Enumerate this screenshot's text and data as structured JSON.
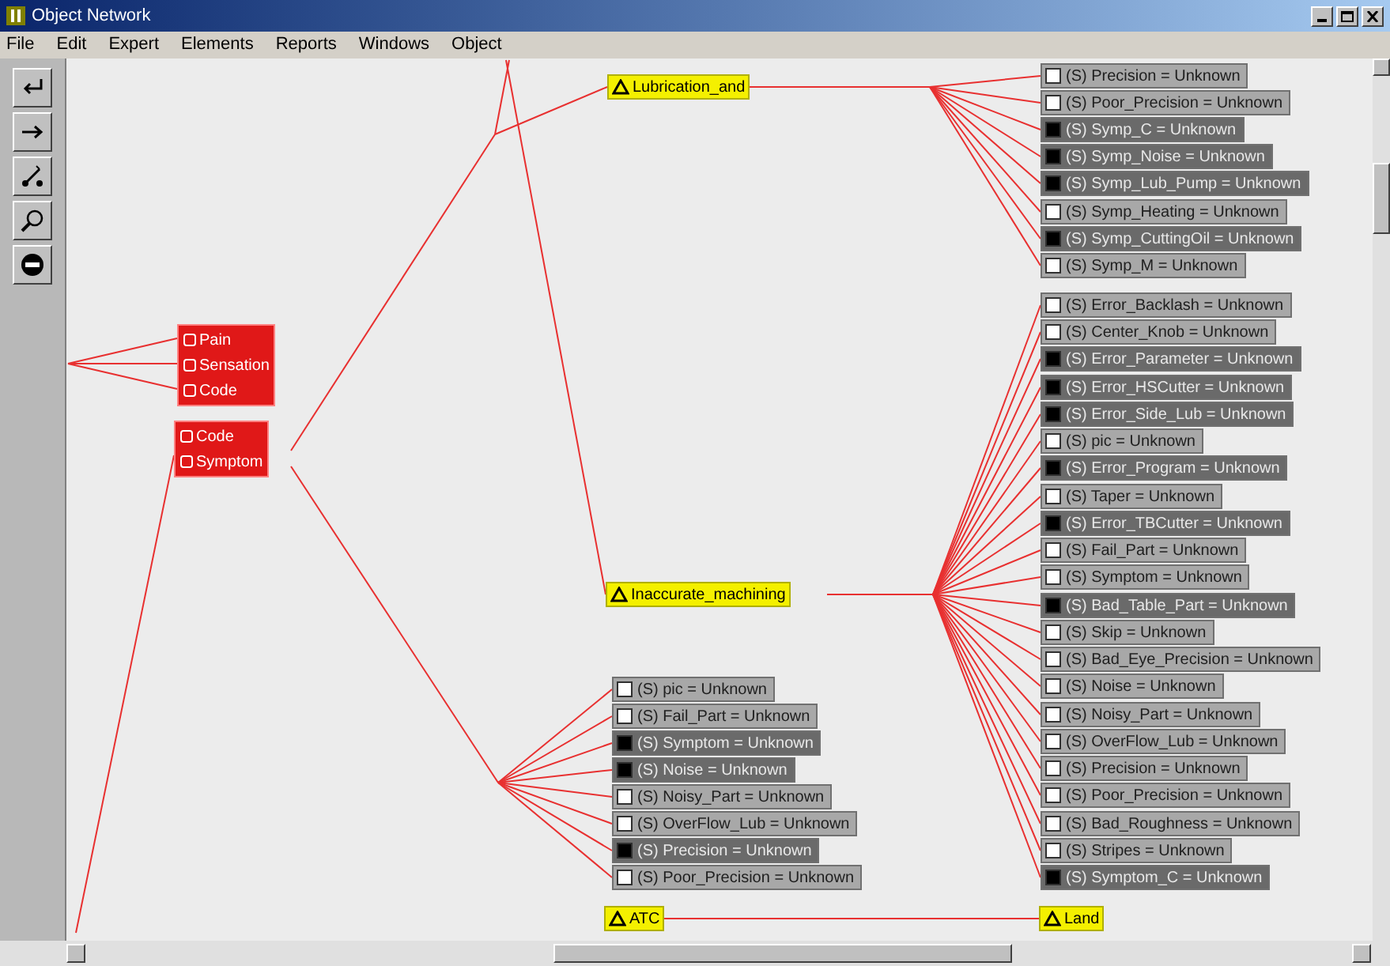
{
  "window": {
    "title": "Object Network"
  },
  "menu": [
    "File",
    "Edit",
    "Expert",
    "Elements",
    "Reports",
    "Windows",
    "Object"
  ],
  "object_groups": [
    {
      "items": [
        "Pain",
        "Sensation",
        "Code"
      ]
    },
    {
      "items": [
        "Code",
        "Symptom"
      ]
    }
  ],
  "rules": [
    {
      "label": "Lubrication_and"
    },
    {
      "label": "Inaccurate_machining"
    },
    {
      "label": "ATC"
    },
    {
      "label": "Land"
    }
  ],
  "attribute_lists": [
    {
      "items": [
        {
          "label": "(S) pic = Unknown",
          "checked": false
        },
        {
          "label": "(S) Fail_Part = Unknown",
          "checked": false
        },
        {
          "label": "(S) Symptom = Unknown",
          "checked": true
        },
        {
          "label": "(S) Noise = Unknown",
          "checked": true
        },
        {
          "label": "(S) Noisy_Part = Unknown",
          "checked": false
        },
        {
          "label": "(S) OverFlow_Lub = Unknown",
          "checked": false
        },
        {
          "label": "(S) Precision = Unknown",
          "checked": true
        },
        {
          "label": "(S) Poor_Precision = Unknown",
          "checked": false
        }
      ]
    },
    {
      "items": [
        {
          "label": "(S) Precision = Unknown",
          "checked": false
        },
        {
          "label": "(S) Poor_Precision = Unknown",
          "checked": false
        },
        {
          "label": "(S) Symp_C = Unknown",
          "checked": true
        },
        {
          "label": "(S) Symp_Noise = Unknown",
          "checked": true
        },
        {
          "label": "(S) Symp_Lub_Pump = Unknown",
          "checked": true
        },
        {
          "label": "(S) Symp_Heating = Unknown",
          "checked": false
        },
        {
          "label": "(S) Symp_CuttingOil = Unknown",
          "checked": true
        },
        {
          "label": "(S) Symp_M = Unknown",
          "checked": false
        }
      ]
    },
    {
      "items": [
        {
          "label": "(S) Error_Backlash = Unknown",
          "checked": false
        },
        {
          "label": "(S) Center_Knob = Unknown",
          "checked": false
        },
        {
          "label": "(S) Error_Parameter = Unknown",
          "checked": true
        },
        {
          "label": "(S) Error_HSCutter = Unknown",
          "checked": true
        },
        {
          "label": "(S) Error_Side_Lub = Unknown",
          "checked": true
        },
        {
          "label": "(S) pic = Unknown",
          "checked": false
        },
        {
          "label": "(S) Error_Program = Unknown",
          "checked": true
        },
        {
          "label": "(S) Taper = Unknown",
          "checked": false
        },
        {
          "label": "(S) Error_TBCutter = Unknown",
          "checked": true
        },
        {
          "label": "(S) Fail_Part = Unknown",
          "checked": false
        },
        {
          "label": "(S) Symptom = Unknown",
          "checked": false
        },
        {
          "label": "(S) Bad_Table_Part = Unknown",
          "checked": true
        },
        {
          "label": "(S) Skip = Unknown",
          "checked": false
        },
        {
          "label": "(S) Bad_Eye_Precision = Unknown",
          "checked": false
        },
        {
          "label": "(S) Noise = Unknown",
          "checked": false
        },
        {
          "label": "(S) Noisy_Part = Unknown",
          "checked": false
        },
        {
          "label": "(S) OverFlow_Lub = Unknown",
          "checked": false
        },
        {
          "label": "(S) Precision = Unknown",
          "checked": false
        },
        {
          "label": "(S) Poor_Precision = Unknown",
          "checked": false
        },
        {
          "label": "(S) Bad_Roughness = Unknown",
          "checked": false
        },
        {
          "label": "(S) Stripes = Unknown",
          "checked": false
        },
        {
          "label": "(S) Symptom_C = Unknown",
          "checked": true
        }
      ]
    }
  ]
}
